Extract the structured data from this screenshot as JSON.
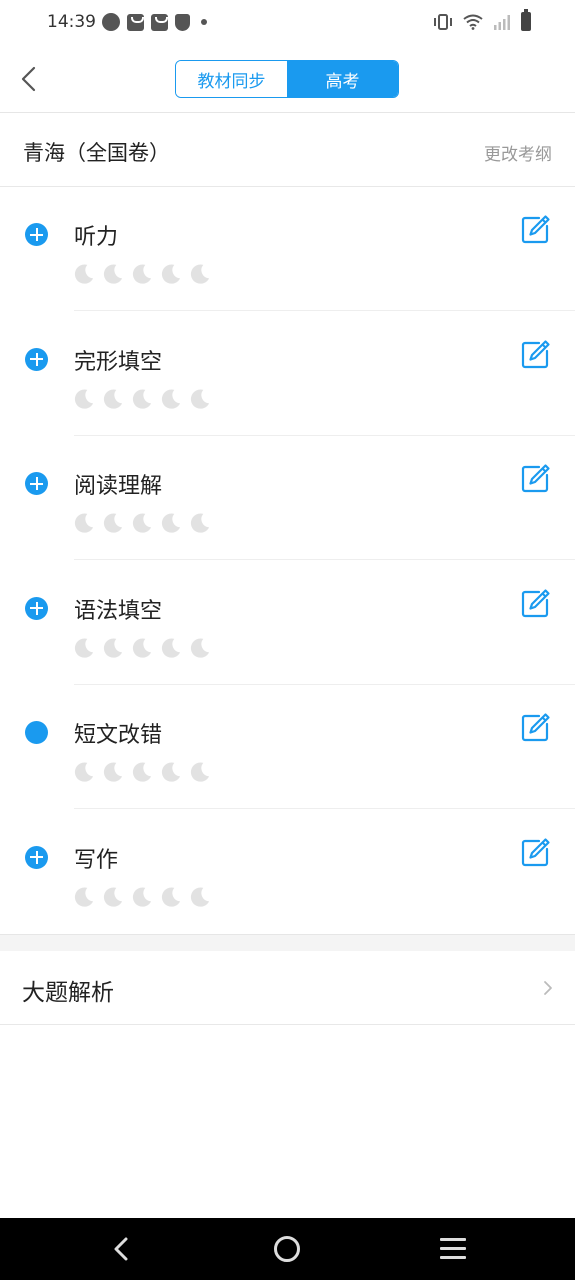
{
  "status_bar": {
    "time": "14:39"
  },
  "header": {
    "tabs": [
      {
        "label": "教材同步",
        "active": false
      },
      {
        "label": "高考",
        "active": true
      }
    ]
  },
  "exam": {
    "title": "青海（全国卷）",
    "change_label": "更改考纲"
  },
  "sections": [
    {
      "label": "听力",
      "icon": "plus-circle-icon",
      "stars": 0
    },
    {
      "label": "完形填空",
      "icon": "plus-circle-icon",
      "stars": 0
    },
    {
      "label": "阅读理解",
      "icon": "plus-circle-icon",
      "stars": 0
    },
    {
      "label": "语法填空",
      "icon": "plus-circle-icon",
      "stars": 0
    },
    {
      "label": "短文改错",
      "icon": "dot-circle-icon",
      "stars": 0
    },
    {
      "label": "写作",
      "icon": "plus-circle-icon",
      "stars": 0
    }
  ],
  "analysis": {
    "label": "大题解析"
  },
  "colors": {
    "accent": "#1a9aef",
    "moon_inactive": "#e2e2e2",
    "muted_text": "#999999"
  }
}
